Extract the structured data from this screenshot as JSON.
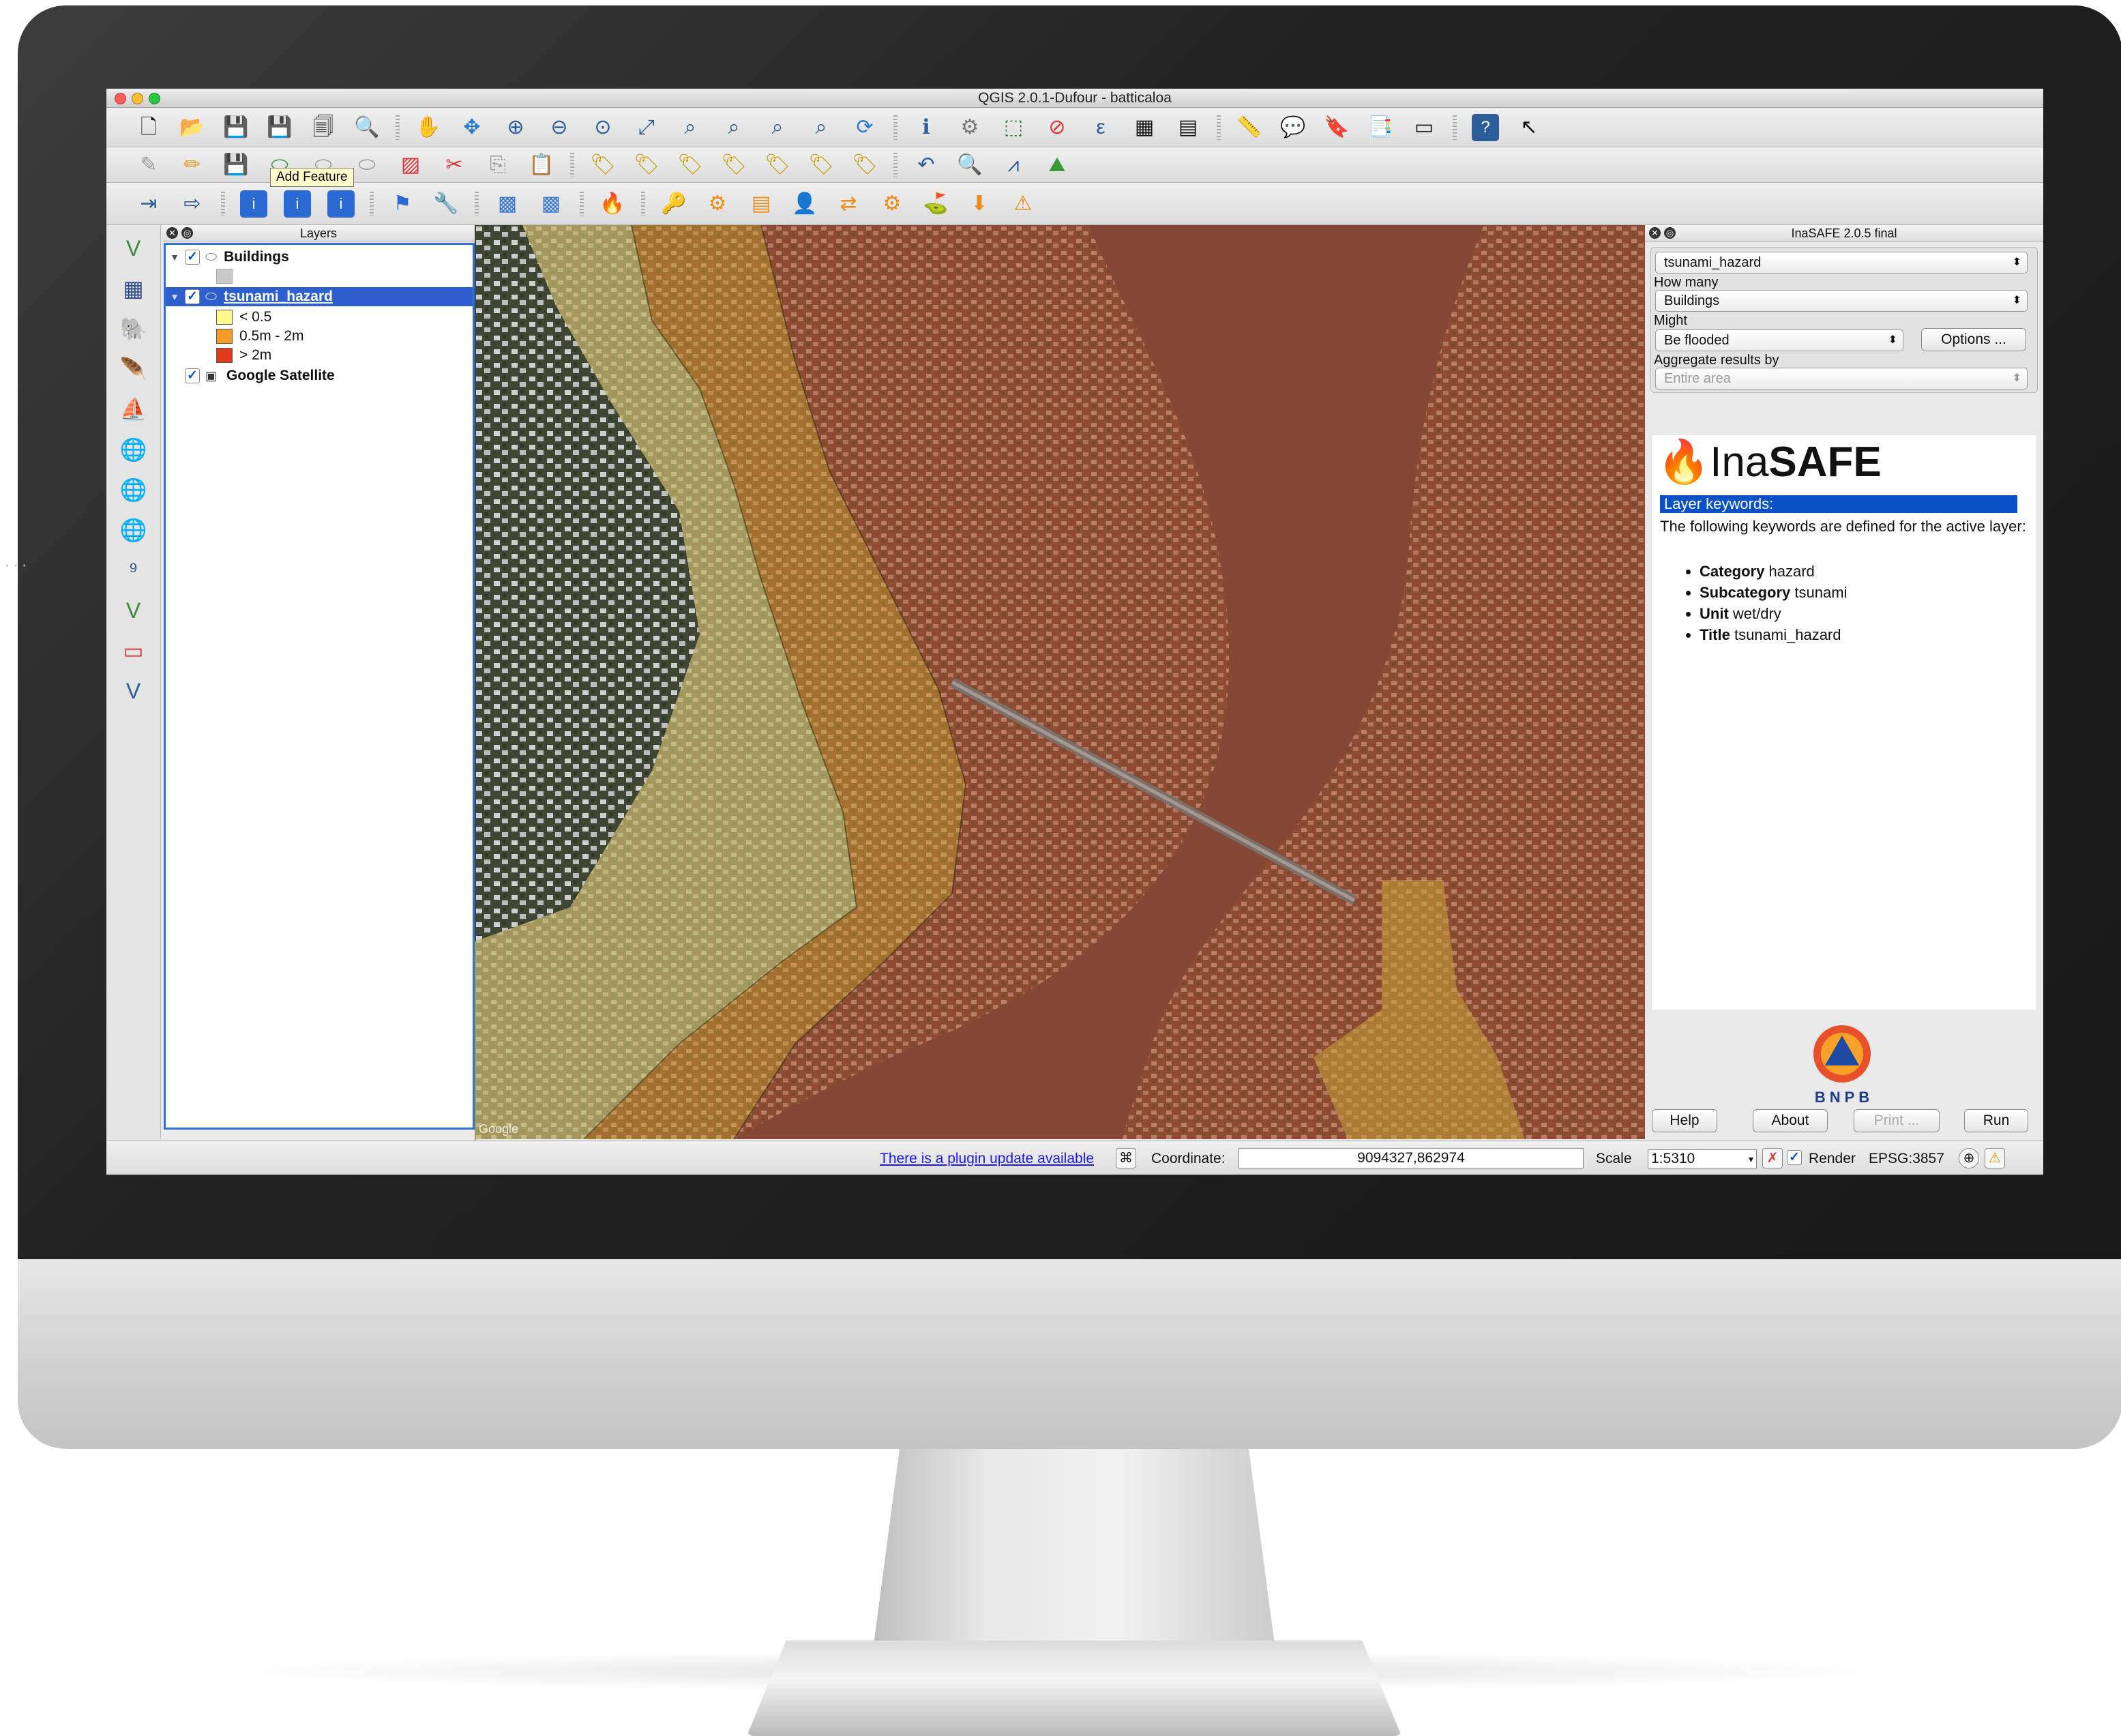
{
  "window": {
    "title": "QGIS 2.0.1-Dufour - batticaloa"
  },
  "tooltip": {
    "text": "Add Feature"
  },
  "layers_panel": {
    "title": "Layers",
    "items": [
      {
        "label": "Buildings"
      },
      {
        "label": "tsunami_hazard",
        "selected": true
      },
      {
        "label": "Google Satellite"
      }
    ],
    "legend": [
      {
        "label": "< 0.5",
        "color": "#fffa8c"
      },
      {
        "label": "0.5m - 2m",
        "color": "#f59a26"
      },
      {
        "label": "> 2m",
        "color": "#e23a1c"
      }
    ]
  },
  "inasafe": {
    "title": "InaSAFE 2.0.5 final",
    "hazard_value": "tsunami_hazard",
    "how_many_label": "How many",
    "exposure_value": "Buildings",
    "might_label": "Might",
    "impact_value": "Be flooded",
    "options_button": "Options ...",
    "aggregate_label": "Aggregate results by",
    "aggregate_value": "Entire area",
    "logo_light": "Ina",
    "logo_bold": "SAFE",
    "keywords_header": "Layer keywords:",
    "keywords_intro": "The following keywords are defined for the active layer:",
    "keywords": [
      {
        "key": "Category",
        "value": "hazard"
      },
      {
        "key": "Subcategory",
        "value": "tsunami"
      },
      {
        "key": "Unit",
        "value": "wet/dry"
      },
      {
        "key": "Title",
        "value": "tsunami_hazard"
      }
    ],
    "bnpb_label": "BNPB",
    "buttons": {
      "help": "Help",
      "about": "About",
      "print": "Print ...",
      "run": "Run"
    }
  },
  "statusbar": {
    "plugin_link": "There is a plugin update available",
    "coordinate_label": "Coordinate:",
    "coordinate_value": "9094327,862974",
    "scale_label": "Scale",
    "scale_value": "1:5310",
    "render_label": "Render",
    "crs": "EPSG:3857"
  },
  "map": {
    "watermark": "Google"
  },
  "colors": {
    "accent": "#0a51c6",
    "hazard_high": "#c5522d",
    "hazard_medium": "#d79a2c",
    "hazard_low": "#dfe08a"
  }
}
